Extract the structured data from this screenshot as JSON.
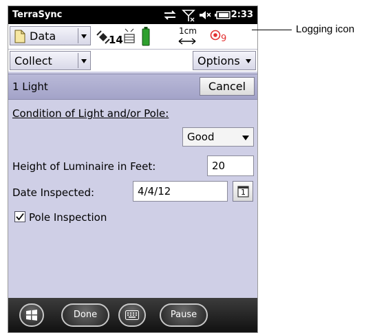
{
  "statusbar": {
    "app_title": "TerraSync",
    "time": "2:33",
    "icons": [
      "sync-arrows-icon",
      "no-signal-icon",
      "speaker-muted-icon",
      "battery-icon"
    ]
  },
  "toolbar": {
    "section_label": "Data",
    "section_icon": "document-icon",
    "satellite_count": "14",
    "accuracy_value": "1cm",
    "logging_count": "9",
    "icons": [
      "satellite-icon",
      "receiver-icon",
      "battery-level-icon",
      "accuracy-arrow-icon",
      "logging-icon"
    ],
    "logging_color": "#e23030"
  },
  "collect": {
    "mode_label": "Collect",
    "options_label": "Options"
  },
  "form": {
    "feature_name": "1 Light",
    "cancel_label": "Cancel",
    "condition_label": "Condition of Light and/or Pole:",
    "condition_value": "Good",
    "height_label": "Height of Luminaire in Feet:",
    "height_value": "20",
    "date_label": "Date Inspected:",
    "date_value": "4/4/12",
    "calendar_day": "1",
    "pole_inspection_label": "Pole Inspection",
    "pole_inspection_checked": true
  },
  "bottombar": {
    "done_label": "Done",
    "pause_label": "Pause",
    "icons": [
      "windows-start-icon",
      "keyboard-icon"
    ]
  },
  "annotation": {
    "text": "Logging icon"
  }
}
